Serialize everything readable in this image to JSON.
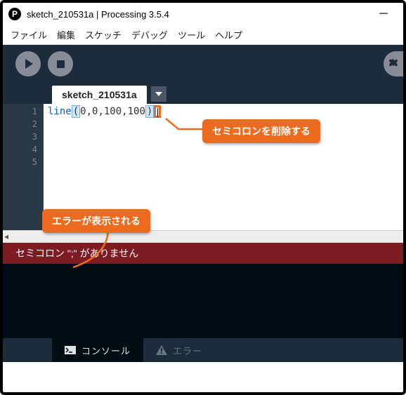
{
  "window": {
    "title": "sketch_210531a | Processing 3.5.4",
    "logo_letter": "P"
  },
  "menu": {
    "items": [
      "ファイル",
      "編集",
      "スケッチ",
      "デバッグ",
      "ツール",
      "ヘルプ"
    ]
  },
  "tabs": {
    "active": "sketch_210531a"
  },
  "editor": {
    "line_numbers": [
      "1",
      "2",
      "3",
      "4",
      "5"
    ],
    "code": {
      "fn": "line",
      "open": "(",
      "args": "0,0,100,100",
      "close": ")"
    }
  },
  "error": {
    "message": "セミコロン \";\" がありません"
  },
  "bottom_tabs": {
    "console": "コンソール",
    "errors": "エラー"
  },
  "callouts": {
    "c1": "セミコロンを削除する",
    "c2": "エラーが表示される"
  }
}
